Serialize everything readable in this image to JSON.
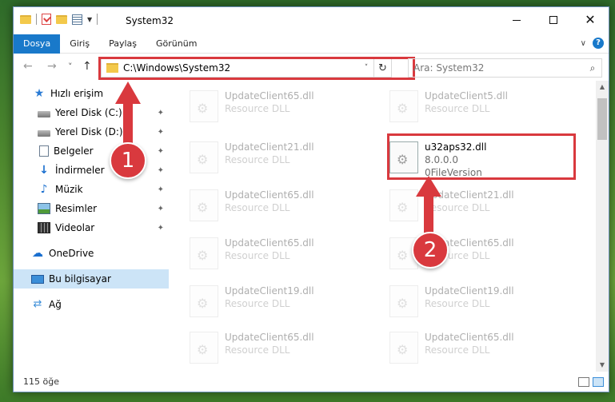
{
  "window": {
    "title": "System32",
    "minimize_label": "",
    "maximize_label": "",
    "close_label": "✕"
  },
  "ribbon": {
    "tabs": [
      {
        "label": "Dosya",
        "active": true
      },
      {
        "label": "Giriş"
      },
      {
        "label": "Paylaş"
      },
      {
        "label": "Görünüm"
      }
    ],
    "help": "?"
  },
  "nav": {
    "back": "←",
    "forward": "→",
    "recent": "˅",
    "up": "↑",
    "address": "C:\\Windows\\System32",
    "address_dropdown": "˅",
    "refresh": "↻",
    "search_placeholder": "Ara: System32",
    "search_icon": "⌕"
  },
  "sidebar": {
    "items": [
      {
        "label": "Hızlı erişim",
        "icon": "star-icon"
      },
      {
        "label": "Yerel Disk (C:)",
        "icon": "disk-icon",
        "pinned": true
      },
      {
        "label": "Yerel Disk (D:)",
        "icon": "disk-icon",
        "pinned": true
      },
      {
        "label": "Belgeler",
        "icon": "document-icon",
        "pinned": true
      },
      {
        "label": "İndirmeler",
        "icon": "download-icon",
        "pinned": true
      },
      {
        "label": "Müzik",
        "icon": "music-icon",
        "pinned": true
      },
      {
        "label": "Resimler",
        "icon": "pictures-icon",
        "pinned": true
      },
      {
        "label": "Videolar",
        "icon": "videos-icon",
        "pinned": true
      },
      {
        "label": "OneDrive",
        "icon": "cloud-icon"
      },
      {
        "label": "Bu bilgisayar",
        "icon": "computer-icon",
        "selected": true
      },
      {
        "label": "Ağ",
        "icon": "network-icon"
      }
    ],
    "pin_glyph": "📌"
  },
  "files": [
    {
      "name": "UpdateClient65.dll",
      "sub": "Resource DLL"
    },
    {
      "name": "UpdateClient5.dll",
      "sub": "Resource DLL"
    },
    {
      "name": "UpdateClient21.dll",
      "sub": "Resource DLL"
    },
    {
      "name": "u32aps32.dll",
      "sub": "8.0.0.0",
      "sub2": "0FileVersion",
      "highlight": true
    },
    {
      "name": "UpdateClient65.dll",
      "sub": "Resource DLL"
    },
    {
      "name": "UpdateClient21.dll",
      "sub": "Resource DLL"
    },
    {
      "name": "UpdateClient65.dll",
      "sub": "Resource DLL"
    },
    {
      "name": "UpdateClient65.dll",
      "sub": "Resource DLL"
    },
    {
      "name": "UpdateClient19.dll",
      "sub": "Resource DLL"
    },
    {
      "name": "UpdateClient19.dll",
      "sub": "Resource DLL"
    },
    {
      "name": "UpdateClient65.dll",
      "sub": "Resource DLL"
    },
    {
      "name": "UpdateClient65.dll",
      "sub": "Resource DLL"
    }
  ],
  "status": {
    "count": "115 öğe"
  },
  "annotations": {
    "badge1": "1",
    "badge2": "2",
    "color": "#d9393e"
  }
}
